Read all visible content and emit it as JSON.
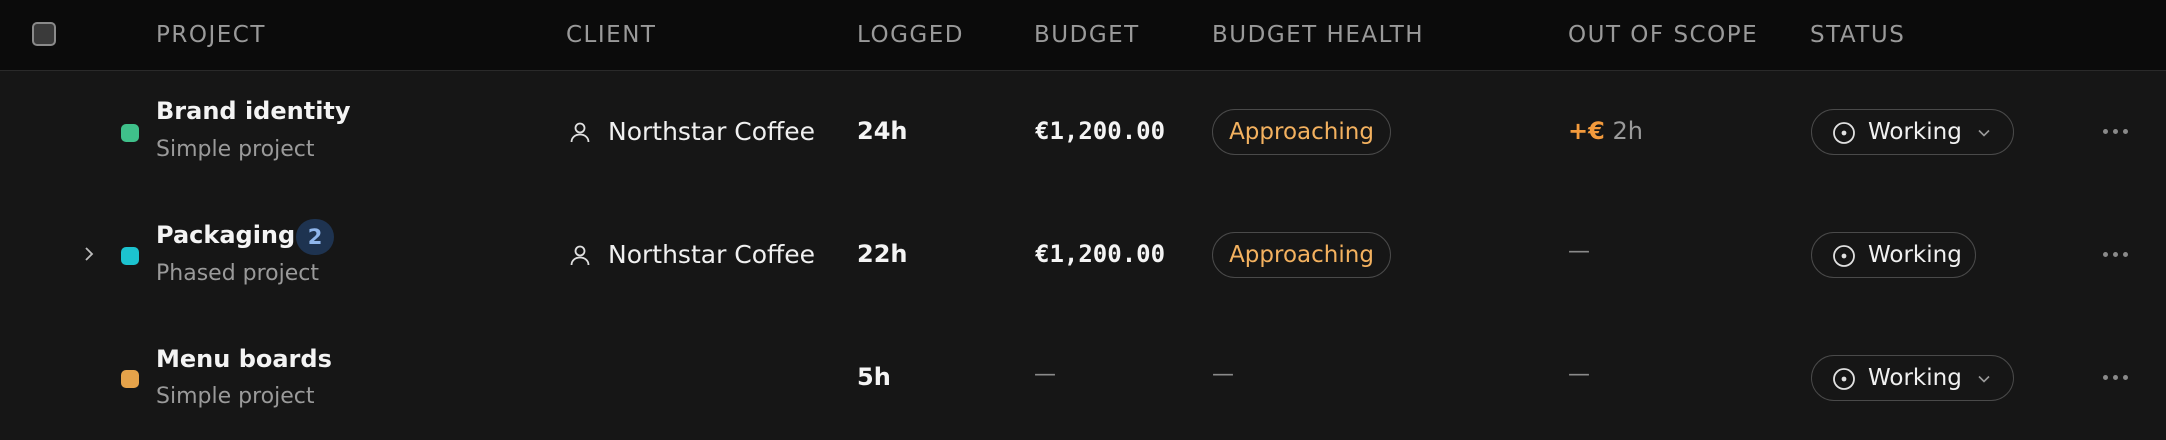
{
  "header": {
    "columns": [
      "PROJECT",
      "CLIENT",
      "LOGGED",
      "BUDGET",
      "BUDGET HEALTH",
      "OUT OF SCOPE",
      "STATUS"
    ]
  },
  "rows": [
    {
      "name": "Brand identity",
      "type": "Simple project",
      "color": "#3fc08a",
      "client": "Northstar Coffee",
      "logged": "24h",
      "budget": "€1,200.00",
      "health": "Approaching",
      "out_of_scope_prefix": "+€",
      "out_of_scope_hours": "2h",
      "status": "Working"
    },
    {
      "name": "Packaging",
      "type": "Phased project",
      "color": "#1cc3cf",
      "phase_count": "2",
      "client": "Northstar Coffee",
      "logged": "22h",
      "budget": "€1,200.00",
      "health": "Approaching",
      "out_of_scope": "—",
      "status": "Working"
    },
    {
      "name": "Menu boards",
      "type": "Simple project",
      "color": "#e6a34a",
      "logged": "5h",
      "budget": "—",
      "health": "—",
      "out_of_scope": "—",
      "status": "Working"
    }
  ],
  "icons": {
    "select_all": "checkbox-icon",
    "client": "user-icon",
    "status": "clock-icon",
    "dropdown": "chevron-down-icon",
    "expand": "chevron-right-icon",
    "more": "more-horizontal-icon"
  }
}
